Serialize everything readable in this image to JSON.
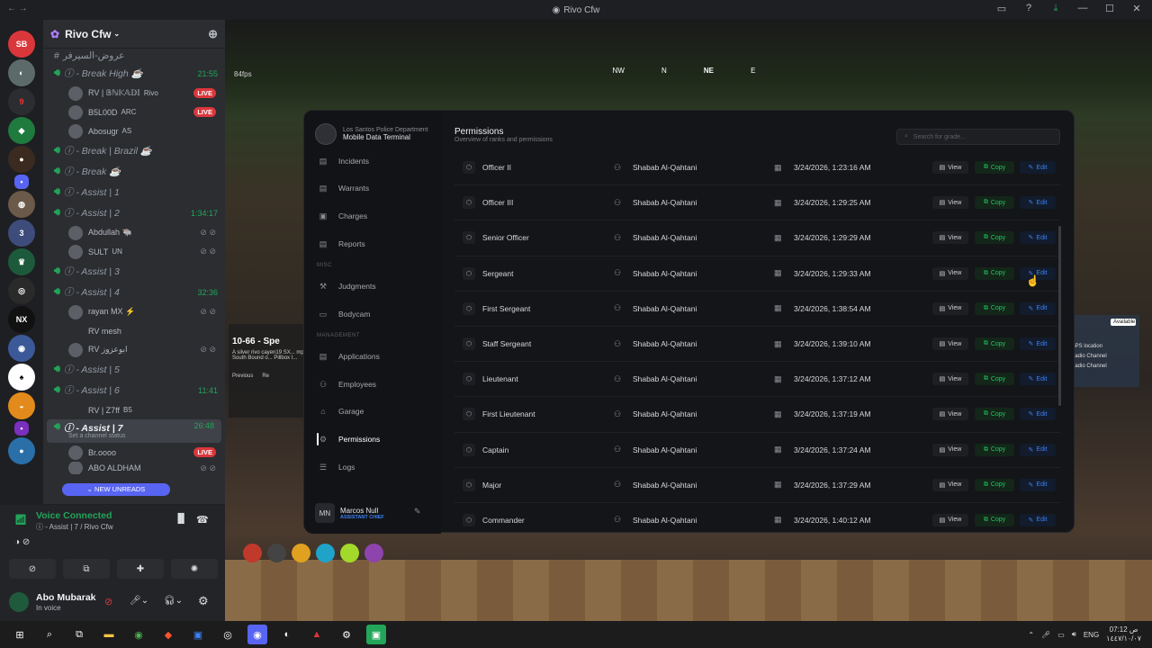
{
  "titlebar": {
    "title": "Rivo Cfw"
  },
  "server": {
    "name": "Rivo Cfw"
  },
  "channels": [
    {
      "label": "عروض-السيرفر",
      "kind": "text"
    },
    {
      "label": "ⓘ - Break High ☕",
      "kind": "voice",
      "time": "21:55"
    },
    {
      "label": "ⓘ - Break | Brazil ☕",
      "kind": "voice"
    },
    {
      "label": "ⓘ - Break ☕",
      "kind": "voice"
    },
    {
      "label": "ⓘ - Assist | 1",
      "kind": "voice"
    },
    {
      "label": "ⓘ - Assist | 2",
      "kind": "voice",
      "time": "1:34:17"
    },
    {
      "label": "ⓘ - Assist | 3",
      "kind": "voice"
    },
    {
      "label": "ⓘ - Assist | 4",
      "kind": "voice",
      "time": "32:36"
    },
    {
      "label": "ⓘ - Assist | 5",
      "kind": "voice"
    },
    {
      "label": "ⓘ - Assist | 6",
      "kind": "voice",
      "time": "11:41"
    },
    {
      "label": "ⓘ - Assist | 7",
      "kind": "voice",
      "time": "26:48",
      "status": "Set a channel status"
    }
  ],
  "users": {
    "break_high": [
      {
        "name": "RV | 𝔹ℕ𝕂𝔸𝔻𝕀",
        "tag": "Rivo",
        "live": false
      },
      {
        "name": "B5L00D",
        "tag": "ARC",
        "live": true
      },
      {
        "name": "Abosugr",
        "tag": "AS",
        "live": false
      }
    ],
    "assist2": [
      {
        "name": "Abdullah 🐃"
      },
      {
        "name": "SULT",
        "tag": "UN"
      }
    ],
    "assist4": [
      {
        "name": "rayan MX ⚡"
      },
      {
        "name": "RV mesh"
      },
      {
        "name": "RV ابوعزوز"
      }
    ],
    "assist6": [
      {
        "name": "RV | Z7ff",
        "tag": "B5"
      }
    ],
    "assist7": [
      {
        "name": "Br.oooo",
        "live": true
      },
      {
        "name": "ABO ALDHAM"
      }
    ]
  },
  "live_label": "LIVE",
  "new_unreads": "NEW UNREADS",
  "voice": {
    "title": "Voice Connected",
    "subtitle": "ⓘ - Assist | 7 / Rivo Cfw"
  },
  "account": {
    "name": "Abo Mubarak",
    "status": "In voice"
  },
  "game": {
    "fps": "84fps",
    "compass": [
      "NW",
      "N",
      "NE",
      "E"
    ],
    "popup": {
      "code": "10-66 - Spe",
      "text": "A silver rivo cayen19 SX... mph South Bound o... Pillbox I...",
      "prev": "Previous",
      "next": "Re"
    },
    "side_panel": {
      "badge": "Available",
      "l1": "GPS location",
      "l2": "Radio Channel",
      "l3": "Radio Channel"
    }
  },
  "mdt": {
    "dept": "Los Santos Police Department",
    "title": "Mobile Data Terminal",
    "section_misc": "MISC",
    "section_mgmt": "MANAGEMENT",
    "nav": [
      {
        "label": "Incidents",
        "icon": "incidents-icon"
      },
      {
        "label": "Warrants",
        "icon": "warrants-icon"
      },
      {
        "label": "Charges",
        "icon": "charges-icon"
      },
      {
        "label": "Reports",
        "icon": "reports-icon"
      },
      {
        "label": "Judgments",
        "icon": "judgments-icon"
      },
      {
        "label": "Bodycam",
        "icon": "bodycam-icon"
      },
      {
        "label": "Applications",
        "icon": "applications-icon"
      },
      {
        "label": "Employees",
        "icon": "employees-icon"
      },
      {
        "label": "Garage",
        "icon": "garage-icon"
      },
      {
        "label": "Permissions",
        "icon": "permissions-icon",
        "active": true
      },
      {
        "label": "Logs",
        "icon": "logs-icon"
      }
    ],
    "page_title": "Permissions",
    "page_sub": "Overview of ranks and permissions",
    "search_placeholder": "Search for grade...",
    "buttons": {
      "view": "View",
      "copy": "Copy",
      "edit": "Edit"
    },
    "user": {
      "initials": "MN",
      "name": "Marcos Null",
      "role": "ASSISTANT CHIEF"
    },
    "rows": [
      {
        "rank": "Officer II",
        "user": "Shabab Al-Qahtani",
        "date": "3/24/2026, 1:23:16 AM"
      },
      {
        "rank": "Officer III",
        "user": "Shabab Al-Qahtani",
        "date": "3/24/2026, 1:29:25 AM"
      },
      {
        "rank": "Senior Officer",
        "user": "Shabab Al-Qahtani",
        "date": "3/24/2026, 1:29:29 AM"
      },
      {
        "rank": "Sergeant",
        "user": "Shabab Al-Qahtani",
        "date": "3/24/2026, 1:29:33 AM"
      },
      {
        "rank": "First Sergeant",
        "user": "Shabab Al-Qahtani",
        "date": "3/24/2026, 1:38:54 AM"
      },
      {
        "rank": "Staff Sergeant",
        "user": "Shabab Al-Qahtani",
        "date": "3/24/2026, 1:39:10 AM"
      },
      {
        "rank": "Lieutenant",
        "user": "Shabab Al-Qahtani",
        "date": "3/24/2026, 1:37:12 AM"
      },
      {
        "rank": "First Lieutenant",
        "user": "Shabab Al-Qahtani",
        "date": "3/24/2026, 1:37:19 AM"
      },
      {
        "rank": "Captain",
        "user": "Shabab Al-Qahtani",
        "date": "3/24/2026, 1:37:24 AM"
      },
      {
        "rank": "Major",
        "user": "Shabab Al-Qahtani",
        "date": "3/24/2026, 1:37:29 AM"
      },
      {
        "rank": "Commander",
        "user": "Shabab Al-Qahtani",
        "date": "3/24/2026, 1:40:12 AM"
      }
    ]
  },
  "taskbar": {
    "lang": "ENG",
    "time": "07:12 ص",
    "date": "١٤٤٧/١٠/٠٧"
  },
  "colors": {
    "accent_green": "#23a55a",
    "live_red": "#da373c",
    "copy_green": "#22c55e",
    "edit_blue": "#3b82f6",
    "discord_blurple": "#5865f2"
  }
}
